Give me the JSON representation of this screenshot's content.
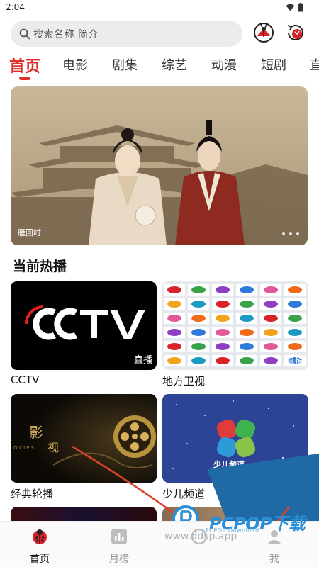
{
  "status_bar": {
    "time": "2:04"
  },
  "search": {
    "placeholder": "搜索名称 简介"
  },
  "tabs": [
    {
      "label": "首页",
      "active": true
    },
    {
      "label": "电影"
    },
    {
      "label": "剧集"
    },
    {
      "label": "综艺"
    },
    {
      "label": "动漫"
    },
    {
      "label": "短剧"
    },
    {
      "label": "直"
    }
  ],
  "banner": {
    "caption": "雁回时",
    "page_count": 3
  },
  "section": {
    "title": "当前热播"
  },
  "cards": [
    {
      "label": "CCTV",
      "badge": "直播",
      "logo_text": "CCTV"
    },
    {
      "label": "地方卫视",
      "badge": "直播"
    },
    {
      "label": "经典轮播",
      "overlay_text_1": "影",
      "overlay_text_2": "视",
      "overlay_text_3": "OVIES"
    },
    {
      "label": "少儿频道",
      "badge": "直播",
      "logo_text": "少儿频道"
    },
    {
      "label": ""
    },
    {
      "label": ""
    }
  ],
  "bottom_nav": [
    {
      "label": "首页",
      "icon": "ladybug-home-icon",
      "active": true
    },
    {
      "label": "月榜",
      "icon": "chart-icon"
    },
    {
      "label": "",
      "icon": "discover-icon"
    },
    {
      "label": "我",
      "icon": "profile-icon"
    }
  ],
  "watermark": {
    "brand": "PCPOP下载",
    "sub": "PCPOP Download",
    "url": "www.ddsp.app"
  },
  "colors": {
    "accent": "#e0302b",
    "watermark_blue": "#1f6aa5"
  }
}
